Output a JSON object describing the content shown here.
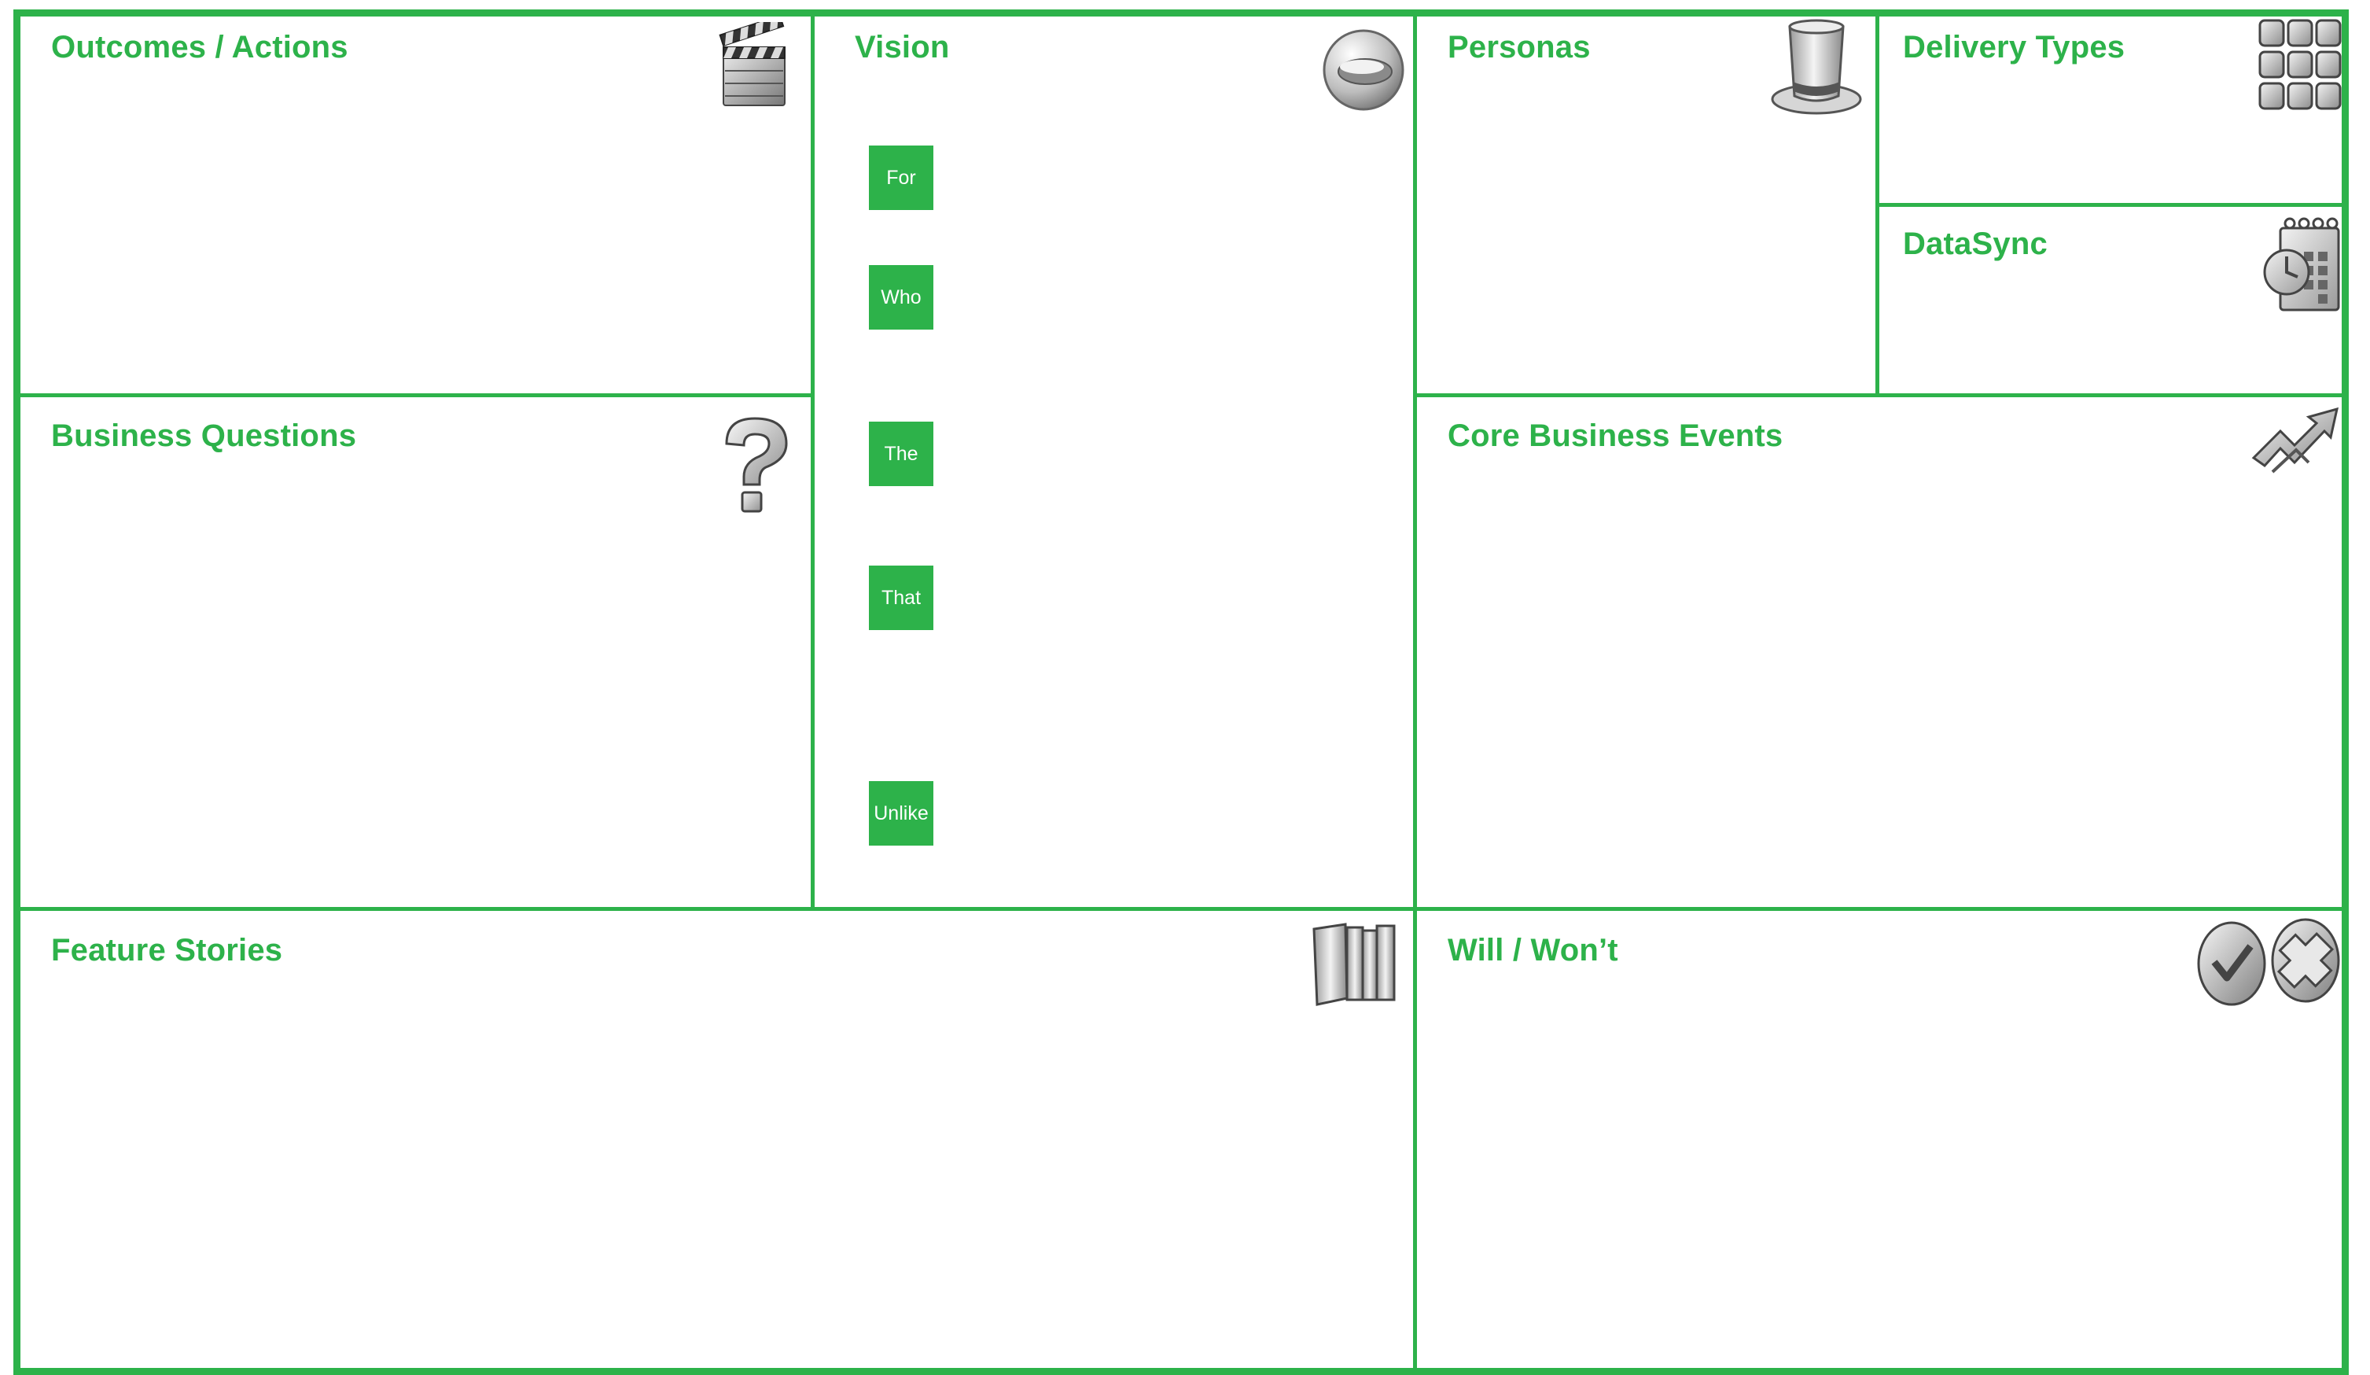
{
  "canvas": {
    "accent_color": "#2db24a",
    "sections": {
      "outcomes": {
        "title": "Outcomes / Actions",
        "icon": "clapperboard-icon"
      },
      "vision": {
        "title": "Vision",
        "icon": "glass-sphere-icon",
        "prompts": [
          "For",
          "Who",
          "The",
          "That",
          "Unlike"
        ]
      },
      "personas": {
        "title": "Personas",
        "icon": "top-hat-icon"
      },
      "delivery_types": {
        "title": "Delivery Types",
        "icon": "grid-cubes-icon"
      },
      "datasync": {
        "title": "DataSync",
        "icon": "calendar-clock-icon"
      },
      "business_questions": {
        "title": "Business Questions",
        "icon": "question-mark-icon"
      },
      "core_business_events": {
        "title": "Core Business Events",
        "icon": "lightning-arrows-icon"
      },
      "feature_stories": {
        "title": "Feature Stories",
        "icon": "books-icon"
      },
      "will_wont": {
        "title": "Will / Won’t",
        "icon": "check-cross-icon"
      }
    }
  }
}
